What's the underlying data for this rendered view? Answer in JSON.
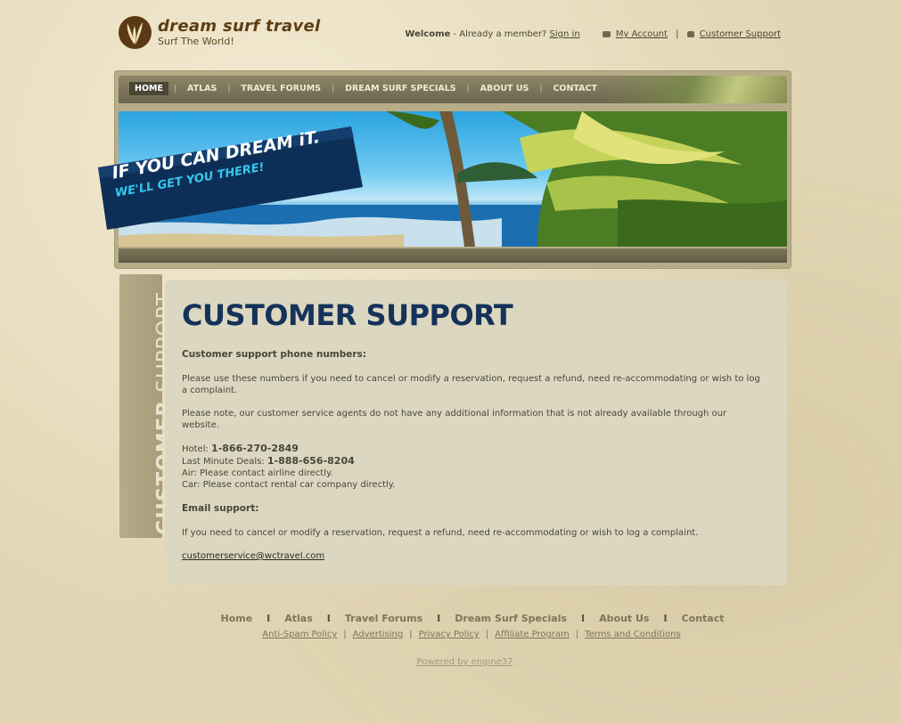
{
  "header": {
    "logo_name": "dream surf travel",
    "logo_tagline": "Surf The World!",
    "welcome": "Welcome",
    "already_member": " - Already a member? ",
    "sign_in": "Sign in",
    "my_account": "My Account",
    "separator": "|",
    "customer_support": "Customer Support"
  },
  "nav": {
    "items": [
      {
        "label": "HOME",
        "active": true
      },
      {
        "label": "ATLAS"
      },
      {
        "label": "TRAVEL FORUMS"
      },
      {
        "label": "DREAM SURF SPECIALS"
      },
      {
        "label": "ABOUT US"
      },
      {
        "label": "CONTACT"
      }
    ],
    "separator": "|"
  },
  "banner": {
    "slogan_line1": "IF YOU CAN DREAM iT.",
    "slogan_line2": "WE'LL GET YOU THERE!"
  },
  "side_label": {
    "bold": "CUSTOMER",
    "light": " SUPPORT"
  },
  "content": {
    "title": "CUSTOMER SUPPORT",
    "phone_heading": "Customer support phone numbers:",
    "para1": "Please use these numbers if you need to cancel or modify a reservation, request a refund, need re-accommodating or wish to log a complaint.",
    "para2": "Please note, our customer service agents do not have any additional information that is not already available through our website.",
    "hotel_label": "Hotel: ",
    "hotel_phone": "1-866-270-2849",
    "lastminute_label": "Last Minute Deals: ",
    "lastminute_phone": "1-888-656-8204",
    "air": "Air: Please contact airline directly.",
    "car": "Car: Please contact rental car company directly.",
    "email_heading": "Email support:",
    "email_para": "If you need to cancel or modify a reservation, request a refund, need re-accommodating or wish to log a complaint.",
    "email": "customerservice@wctravel.com"
  },
  "footer": {
    "nav": [
      "Home",
      "Atlas",
      "Travel Forums",
      "Dream Surf Specials",
      "About Us",
      "Contact"
    ],
    "nav_separator": "I",
    "links": [
      "Anti-Spam Policy",
      "Advertising",
      "Privacy Policy",
      "Affiliate Program",
      "Terms and Conditions"
    ],
    "links_separator": "|",
    "powered": "Powered by engine37"
  },
  "colors": {
    "background": "#e2d6b4",
    "title_navy": "#15335a",
    "nav_bar": "#6b654d",
    "panel": "#dcd7c0",
    "slogan_accent": "#35c7ef"
  },
  "icons": {
    "logo": "palm-leaf-logo",
    "my_account": "users-icon",
    "customer_support": "chat-bubble-icon"
  }
}
